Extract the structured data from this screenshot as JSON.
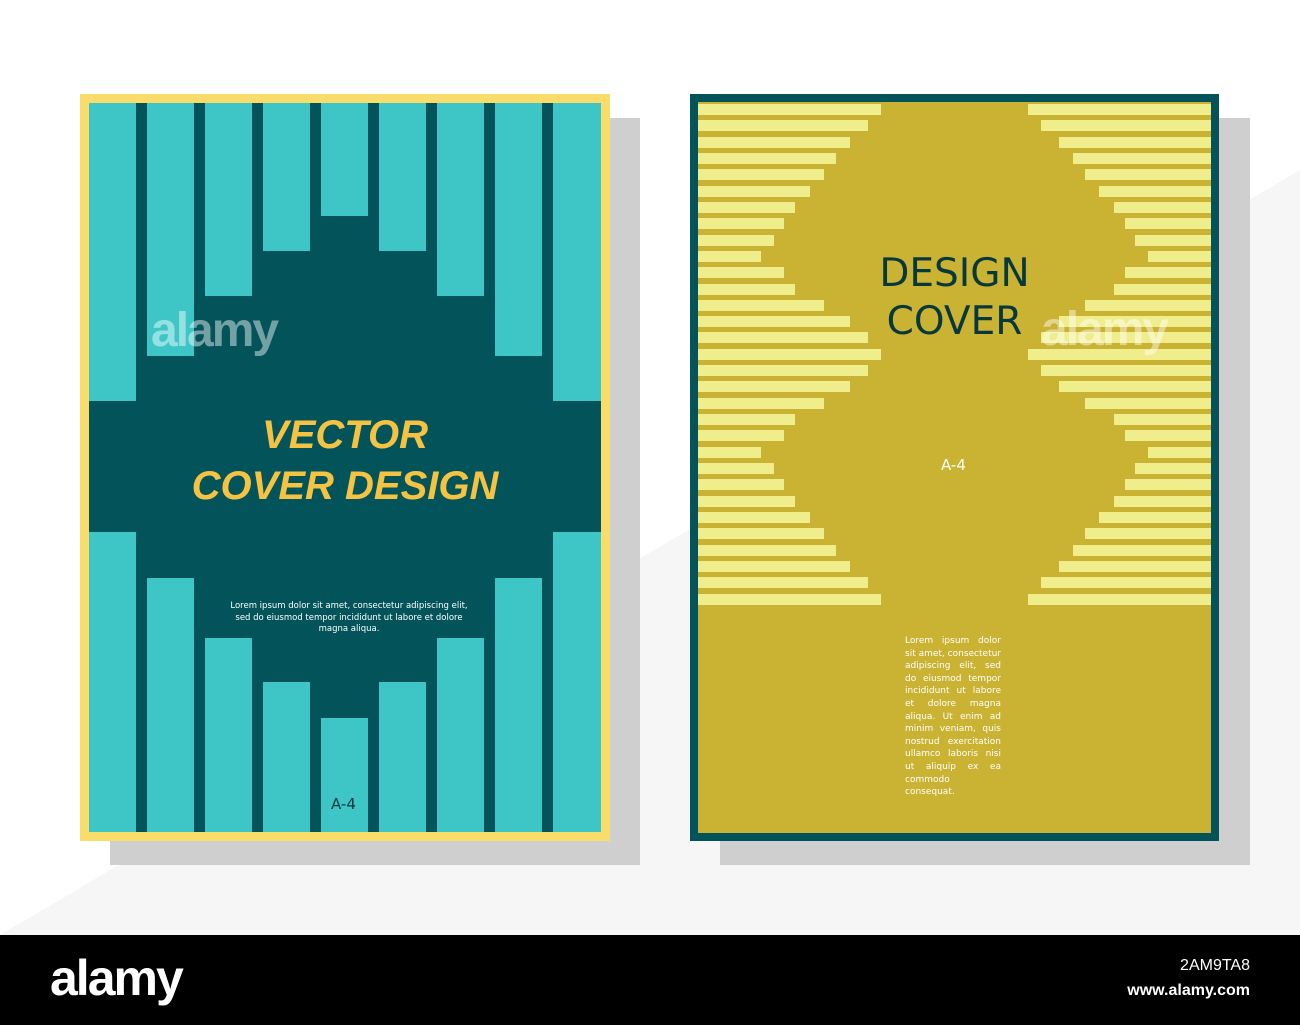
{
  "left_cover": {
    "title_line1": "VECTOR",
    "title_line2": "COVER DESIGN",
    "body_text": "Lorem ipsum dolor sit amet, consectetur adipiscing elit, sed do eiusmod tempor incididunt ut labore et dolore magna aliqua.",
    "page_size": "A-4"
  },
  "right_cover": {
    "title_line1": "DESIGN",
    "title_line2": "COVER",
    "page_size": "A-4",
    "body_text": "Lorem ipsum dolor sit amet, consectetur adipiscing elit, sed do eiusmod tempor incididunt ut labore et dolore magna aliqua. Ut enim ad minim veniam, quis nostrud exercitation ullamco laboris nisi ut aliquip ex ea commodo consequat."
  },
  "watermark": "alamy",
  "footer": {
    "logo": "alamy",
    "image_id": "2AM9TA8",
    "website": "www.alamy.com"
  },
  "colors": {
    "left_border": "#f9dc6a",
    "left_dark": "#02545a",
    "left_bars": "#3ec6c6",
    "left_title": "#f5c242",
    "right_border": "#02545a",
    "right_bg": "#cab232",
    "right_stripes": "#f0ee8c"
  }
}
